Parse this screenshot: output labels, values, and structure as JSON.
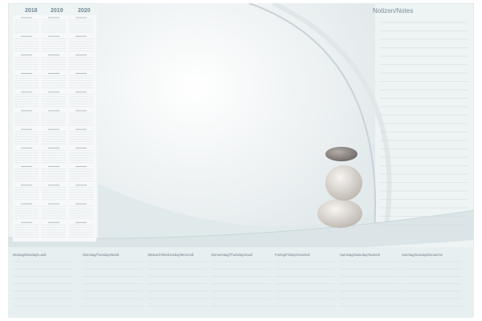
{
  "calendar": {
    "years": [
      "2018",
      "2019",
      "2020"
    ],
    "month_blocks_per_year": 12
  },
  "notes": {
    "title": "Notizen/Notes"
  },
  "week": {
    "days": [
      "Montag/Monday/Lundi",
      "Dienstag/Tuesday/Mardi",
      "Mittwoch/Wednesday/Mercredi",
      "Donnerstag/Thursday/Jeudi",
      "Freitag/Friday/Vendredi",
      "Samstag/Saturday/Samedi",
      "Sonntag/Sunday/Dimanche"
    ]
  },
  "colors": {
    "calendar_text": "#8aa0a8",
    "header_text": "#6f8a93",
    "line": "#c9d6da",
    "background_light": "#e9eff1",
    "band": "#dbe5e8",
    "stone_dark": "#8e8782",
    "stone_light": "#ece8e3"
  },
  "image": {
    "subject": "stacked-stones"
  }
}
